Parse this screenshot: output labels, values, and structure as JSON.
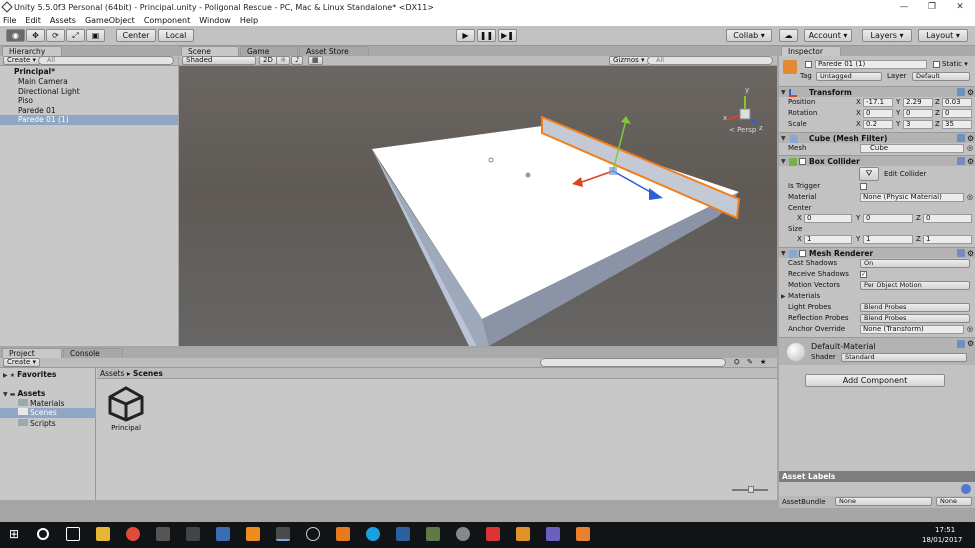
{
  "window": {
    "title": "Unity 5.5.0f3 Personal (64bit) - Principal.unity - Poligonal Rescue - PC, Mac & Linux Standalone* <DX11>",
    "min": "—",
    "max": "❐",
    "close": "✕"
  },
  "menu": [
    "File",
    "Edit",
    "Assets",
    "GameObject",
    "Component",
    "Window",
    "Help"
  ],
  "toolbar": {
    "center": "Center",
    "local": "Local",
    "collab": "Collab ▾",
    "account": "Account ▾",
    "layers": "Layers ▾",
    "layout": "Layout ▾"
  },
  "hierarchy": {
    "tab": "Hierarchy",
    "create": "Create ▾",
    "search": "All",
    "scene": "Principal*",
    "items": [
      "Main Camera",
      "Directional Light",
      "Piso",
      "Parede 01",
      "Parede 01 (1)"
    ]
  },
  "scene": {
    "tabs": [
      "Scene",
      "Game",
      "Asset Store"
    ],
    "shaded": "Shaded",
    "mode2d": "2D",
    "gizmos": "Gizmos ▾",
    "search": "All",
    "persp": "< Persp",
    "axes": {
      "y": "y",
      "x": "x",
      "z": "z"
    }
  },
  "inspector": {
    "tab": "Inspector",
    "objname": "Parede 01 (1)",
    "static": "Static ▾",
    "tag_label": "Tag",
    "tag": "Untagged",
    "layer_label": "Layer",
    "layer": "Default",
    "transform": {
      "title": "Transform",
      "position_label": "Position",
      "rotation_label": "Rotation",
      "scale_label": "Scale",
      "position": {
        "x": "-17.1",
        "y": "2.29",
        "z": "0.03"
      },
      "rotation": {
        "x": "0",
        "y": "0",
        "z": "0"
      },
      "scale": {
        "x": "0.2",
        "y": "3",
        "z": "35"
      }
    },
    "meshfilter": {
      "title": "Cube (Mesh Filter)",
      "mesh_label": "Mesh",
      "mesh": "Cube"
    },
    "boxcollider": {
      "title": "Box Collider",
      "edit": "Edit Collider",
      "trigger_label": "Is Trigger",
      "material_label": "Material",
      "material": "None (Physic Material)",
      "center_label": "Center",
      "size_label": "Size",
      "center": {
        "x": "0",
        "y": "0",
        "z": "0"
      },
      "size": {
        "x": "1",
        "y": "1",
        "z": "1"
      }
    },
    "meshrenderer": {
      "title": "Mesh Renderer",
      "cast_label": "Cast Shadows",
      "cast": "On",
      "receive_label": "Receive Shadows",
      "motion_label": "Motion Vectors",
      "motion": "Per Object Motion",
      "materials_label": "Materials",
      "light_label": "Light Probes",
      "light": "Blend Probes",
      "reflection_label": "Reflection Probes",
      "reflection": "Blend Probes",
      "anchor_label": "Anchor Override",
      "anchor": "None (Transform)"
    },
    "material": {
      "name": "Default-Material",
      "shader_label": "Shader",
      "shader": "Standard"
    },
    "add_component": "Add Component",
    "asset_labels": "Asset Labels",
    "assetbundle_label": "AssetBundle",
    "assetbundle": "None",
    "assetbundle2": "None"
  },
  "project": {
    "tabs": [
      "Project",
      "Console"
    ],
    "create": "Create ▾",
    "favorites": "Favorites",
    "assets": "Assets",
    "folders": [
      "Materials",
      "Scenes",
      "Scripts"
    ],
    "breadcrumb": [
      "Assets",
      "Scenes"
    ],
    "asset": "Principal"
  },
  "taskbar": {
    "time": "17:51",
    "date": "18/01/2017"
  },
  "colors": {
    "selection": "#8fa6c4",
    "orange": "#f07f1b",
    "unity_bg": "#c2c2c2"
  }
}
